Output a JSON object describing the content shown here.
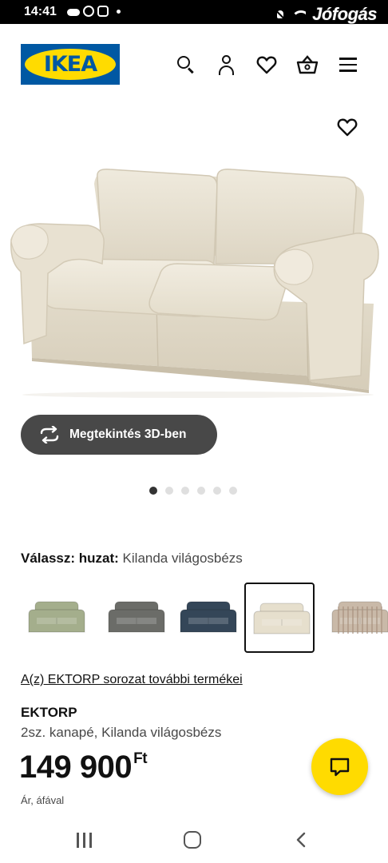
{
  "status_bar": {
    "time": "14:41",
    "watermark": "Jófogás",
    "icons": [
      "cloud-icon",
      "whatsapp-icon",
      "instagram-icon",
      "notification-dot-icon",
      "mute-icon",
      "wifi-icon"
    ]
  },
  "header": {
    "logo_text": "IKEA",
    "icons": [
      "search-icon",
      "user-icon",
      "heart-icon",
      "basket-icon",
      "menu-icon"
    ]
  },
  "gallery": {
    "view_3d_label": "Megtekintés 3D-ben",
    "dot_count": 6,
    "active_dot": 0
  },
  "variant": {
    "label": "Válassz: huzat:",
    "value": "Kilanda világosbézs",
    "swatches": [
      {
        "color": "#a4ae8c",
        "selected": false
      },
      {
        "color": "#6b6c68",
        "selected": false
      },
      {
        "color": "#344658",
        "selected": false
      },
      {
        "color": "#e6dfcd",
        "selected": true
      },
      {
        "color": "#c9b9a8",
        "selected": false,
        "striped": true
      }
    ]
  },
  "product": {
    "series_link": "A(z) EKTORP sorozat további termékei",
    "name": "EKTORP",
    "description": "2sz. kanapé, Kilanda világosbézs",
    "price": "149 900",
    "currency": "Ft",
    "price_note": "Ár, áfával"
  },
  "colors": {
    "ikea_blue": "#0058a3",
    "ikea_yellow": "#ffdb00",
    "button_dark": "#484848"
  }
}
